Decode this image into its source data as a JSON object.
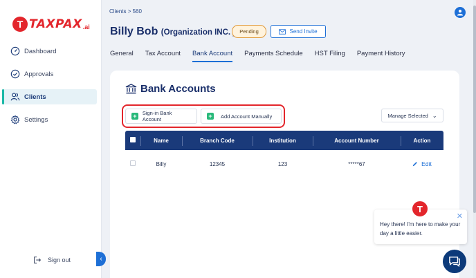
{
  "logo": {
    "mark": "T",
    "text": "TAXPAX",
    "suffix": ".ai"
  },
  "sidebar": {
    "items": [
      {
        "label": "Dashboard",
        "icon": "gauge-icon"
      },
      {
        "label": "Approvals",
        "icon": "check-circle-icon"
      },
      {
        "label": "Clients",
        "icon": "users-icon",
        "active": true
      },
      {
        "label": "Settings",
        "icon": "gear-icon"
      }
    ],
    "signout": "Sign out"
  },
  "breadcrumb": {
    "parent": "Clients",
    "separator": ">",
    "current": "560"
  },
  "client": {
    "name": "Billy Bob",
    "org": "(Organization INC. )",
    "status": "Pending",
    "invite_label": "Send Invite"
  },
  "tabs": [
    "General",
    "Tax Account",
    "Bank Account",
    "Payments Schedule",
    "HST Filing",
    "Payment History"
  ],
  "active_tab": "Bank Account",
  "card": {
    "title": "Bank Accounts",
    "signin_label": "Sign-in Bank Account",
    "add_manual_label": "Add Account Manually",
    "manage_label": "Manage Selected"
  },
  "table": {
    "headers": [
      "Name",
      "Branch Code",
      "Institution",
      "Account Number",
      "Action"
    ],
    "rows": [
      {
        "name": "Billy",
        "branch": "12345",
        "institution": "123",
        "account": "*****67",
        "action": "Edit"
      }
    ]
  },
  "chat": {
    "avatar": "T",
    "message": "Hey there! I'm here to make your day a little easier.",
    "close": "✕"
  },
  "colors": {
    "brand": "#e3262c",
    "accent": "#1d6fd6",
    "header": "#1a3a7a",
    "success": "#28b97a"
  }
}
